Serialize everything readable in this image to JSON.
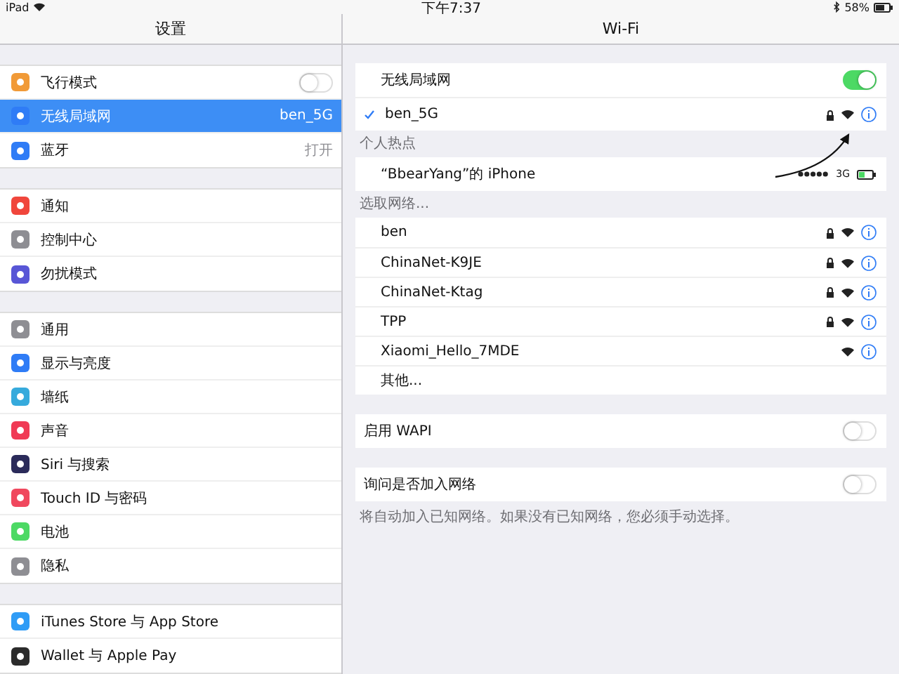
{
  "status_bar": {
    "device": "iPad",
    "time": "下午7:37",
    "battery": "58%"
  },
  "sidebar": {
    "title": "设置",
    "groups": [
      [
        {
          "label": "飞行模式",
          "kind": "toggle",
          "on": false,
          "selected": false,
          "color": "#f19a37"
        },
        {
          "label": "无线局域网",
          "kind": "value",
          "value": "ben_5G",
          "selected": true,
          "color": "#2f7cf6"
        },
        {
          "label": "蓝牙",
          "kind": "value",
          "value": "打开",
          "selected": false,
          "color": "#2f7cf6"
        }
      ],
      [
        {
          "label": "通知",
          "kind": "plain",
          "selected": false,
          "color": "#f0463c"
        },
        {
          "label": "控制中心",
          "kind": "plain",
          "selected": false,
          "color": "#8e8e93"
        },
        {
          "label": "勿扰模式",
          "kind": "plain",
          "selected": false,
          "color": "#5856d6"
        }
      ],
      [
        {
          "label": "通用",
          "kind": "plain",
          "selected": false,
          "color": "#8e8e93"
        },
        {
          "label": "显示与亮度",
          "kind": "plain",
          "selected": false,
          "color": "#2f7cf6"
        },
        {
          "label": "墙纸",
          "kind": "plain",
          "selected": false,
          "color": "#36aadc"
        },
        {
          "label": "声音",
          "kind": "plain",
          "selected": false,
          "color": "#f03a55"
        },
        {
          "label": "Siri 与搜索",
          "kind": "plain",
          "selected": false,
          "color": "#2b2b5a"
        },
        {
          "label": "Touch ID 与密码",
          "kind": "plain",
          "selected": false,
          "color": "#f0485e"
        },
        {
          "label": "电池",
          "kind": "plain",
          "selected": false,
          "color": "#4cd964"
        },
        {
          "label": "隐私",
          "kind": "plain",
          "selected": false,
          "color": "#8e8e93"
        }
      ],
      [
        {
          "label": "iTunes Store 与 App Store",
          "kind": "plain",
          "selected": false,
          "color": "#2f9cf6"
        },
        {
          "label": "Wallet 与 Apple Pay",
          "kind": "plain",
          "selected": false,
          "color": "#2b2b2b"
        }
      ]
    ]
  },
  "detail": {
    "title": "Wi-Fi",
    "wifi_switch": {
      "label": "无线局域网",
      "on": true
    },
    "connected": {
      "name": "ben_5G",
      "locked": true
    },
    "hotspot_header": "个人热点",
    "hotspot": {
      "name": "“BbearYang”的 iPhone",
      "network": "3G"
    },
    "networks_header": "选取网络...",
    "networks": [
      {
        "name": "ben",
        "locked": true
      },
      {
        "name": "ChinaNet-K9JE",
        "locked": true
      },
      {
        "name": "ChinaNet-Ktag",
        "locked": true
      },
      {
        "name": "TPP",
        "locked": true
      },
      {
        "name": "Xiaomi_Hello_7MDE",
        "locked": false
      }
    ],
    "other": "其他...",
    "settings": [
      {
        "label": "启用 WAPI",
        "on": false
      },
      {
        "label": "询问是否加入网络",
        "on": false
      }
    ],
    "footer": "将自动加入已知网络。如果没有已知网络，您必须手动选择。"
  }
}
